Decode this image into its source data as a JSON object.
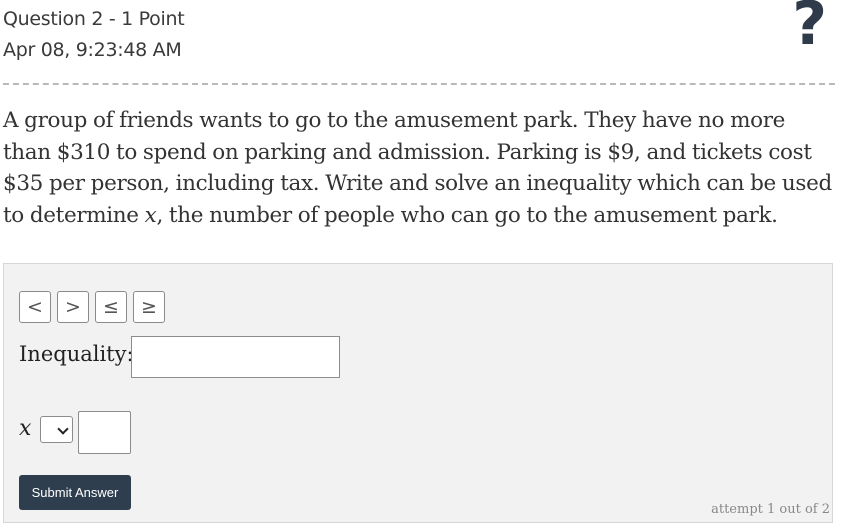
{
  "header": {
    "question_title": "Question 2 - 1 Point",
    "timestamp": "Apr 08, 9:23:48 AM",
    "help_icon": "?"
  },
  "question": {
    "text_before_var": "A group of friends wants to go to the amusement park. They have no more than $310 to spend on parking and admission. Parking is $9, and tickets cost $35 per person, including tax. Write and solve an inequality which can be used to determine ",
    "variable": "x",
    "text_after_var": ", the number of people who can go to the amusement park."
  },
  "answer": {
    "symbols": [
      "<",
      ">",
      "≤",
      "≥"
    ],
    "inequality_label": "Inequality:",
    "inequality_value": "",
    "variable_label": "x",
    "relation_selected": "",
    "number_value": "",
    "submit_label": "Submit Answer",
    "attempt_text": "attempt 1 out of 2"
  },
  "colors": {
    "submit_bg": "#2f3e4f",
    "panel_bg": "#f2f2f2",
    "help_icon": "#2f3a4a"
  }
}
